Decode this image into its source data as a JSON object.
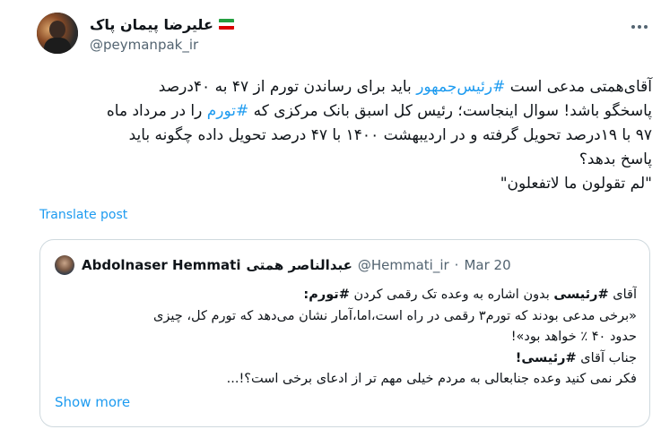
{
  "author": {
    "display_name": "علیرضا پیمان پاک",
    "handle": "@peymanpak_ir",
    "flag_colors": [
      "#239f40",
      "#ffffff",
      "#da0000"
    ]
  },
  "tweet": {
    "line1_pre": "آقای‌همتی مدعی است ",
    "line1_tag": "#رئیس‌جمهور",
    "line1_post": " باید برای رساندن تورم از ۴۷ به ۴۰درصد",
    "line2_pre": "پاسخگو باشد! سوال اینجاست؛ رئیس کل اسبق بانک مرکزی که ",
    "line2_tag": "#تورم",
    "line2_post": " را در مرداد ماه",
    "line3": "۹۷ با ۱۹درصد تحویل گرفته و در اردیبهشت ۱۴۰۰ با ۴۷ درصد تحویل داده چگونه باید",
    "line4": "پاسخ بدهد؟",
    "line5": "\"لم تقولون ما لاتفعلون\""
  },
  "translate_label": "Translate post",
  "quote": {
    "name_en": "Abdolnaser Hemmati",
    "name_fa": "عبدالناصر همتی",
    "handle": "@Hemmati_ir",
    "separator": "·",
    "date": "Mar 20",
    "line1_pre": "آقای ",
    "line1_b1": "#رئیسی",
    "line1_mid": " بدون اشاره به وعده تک رقمی کردن ",
    "line1_b2": "#تورم:",
    "line2": "«برخی مدعی بودند که تورم۳ رقمی در راه است،اما،آمار نشان می‌دهد که تورم کل، چیزی",
    "line3": "حدود ۴۰ ٪ خواهد بود»!",
    "line4_pre": "جناب آقای ",
    "line4_b": "#رئیسی!",
    "line5": "فکر نمی کنید وعده جنابعالی به مردم خیلی مهم تر از ادعای برخی است؟!...",
    "show_more": "Show more"
  },
  "colors": {
    "link": "#1d9bf0",
    "secondary_text": "#536471",
    "border": "#cfd9de"
  }
}
